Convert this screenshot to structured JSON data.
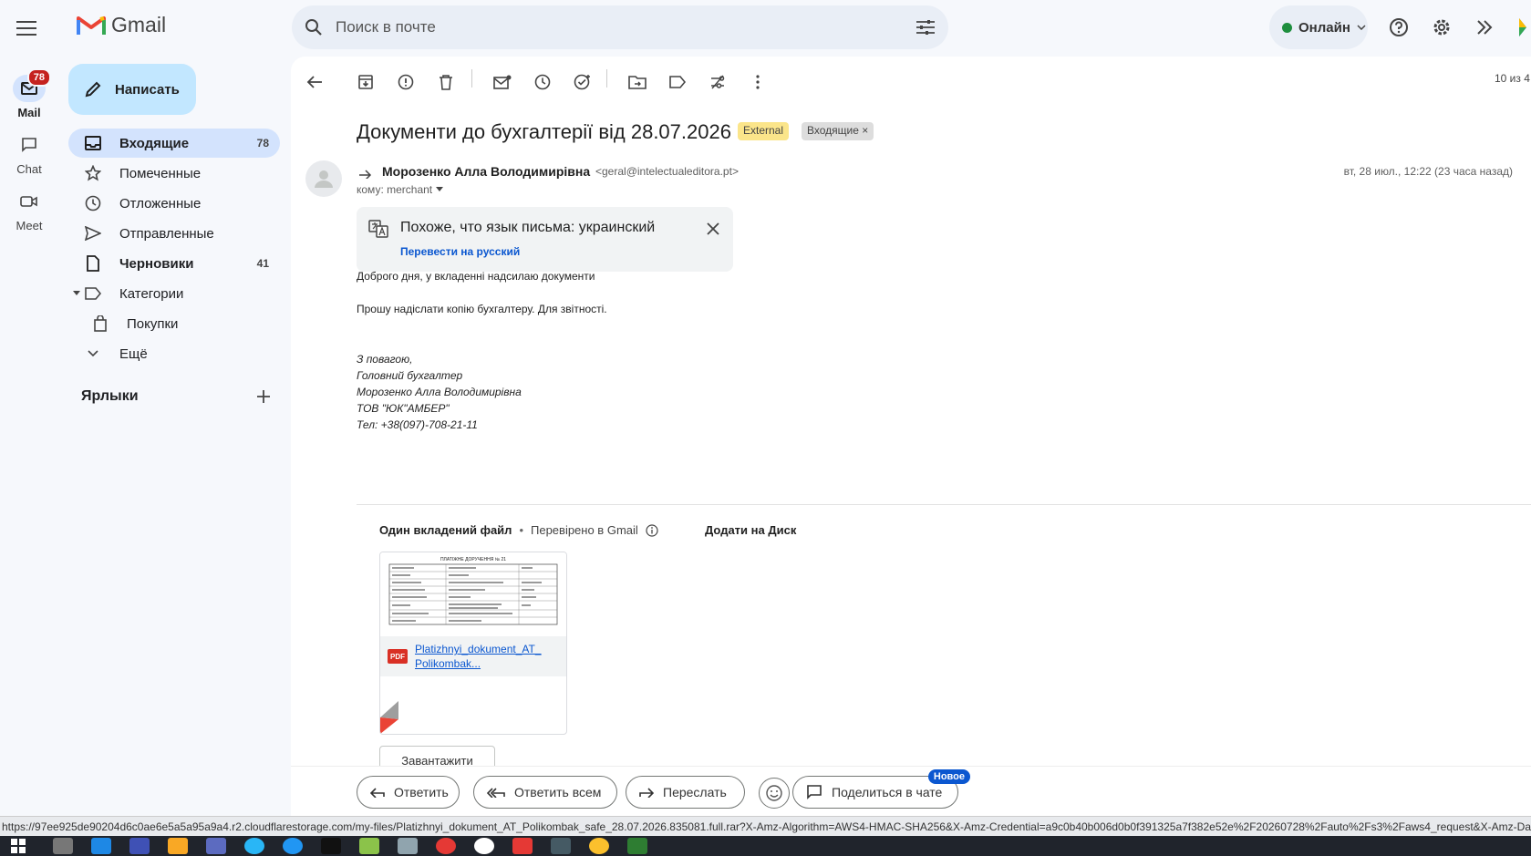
{
  "app": {
    "name": "Gmail"
  },
  "rail": {
    "items": [
      {
        "label": "Mail",
        "badge": "78"
      },
      {
        "label": "Chat"
      },
      {
        "label": "Meet"
      }
    ]
  },
  "search": {
    "placeholder": "Поиск в почте"
  },
  "status": {
    "label": "Онлайн",
    "color": "#1e8e3e"
  },
  "compose": {
    "label": "Написать"
  },
  "nav": {
    "items": [
      {
        "label": "Входящие",
        "count": "78"
      },
      {
        "label": "Помеченные"
      },
      {
        "label": "Отложенные"
      },
      {
        "label": "Отправленные"
      },
      {
        "label": "Черновики",
        "count": "41"
      },
      {
        "label": "Категории"
      },
      {
        "label": "Покупки"
      },
      {
        "label": "Ещё"
      }
    ]
  },
  "labels": {
    "title": "Ярлыки"
  },
  "pager": {
    "text": "10 из 4"
  },
  "email": {
    "subject": "Документи до бухгалтерії від 28.07.2026",
    "tags": [
      "External",
      "Входящие ×"
    ],
    "sender_name": "Морозенко Алла Володимирівна",
    "sender_email": "<geral@intelectualeditora.pt>",
    "to": "кому: merchant",
    "date": "вт, 28 июл., 12:22 (23 часа назад)",
    "translate": {
      "text": "Похоже, что язык письма: украинский",
      "link": "Перевести на русский"
    },
    "body": [
      "Доброго дня, у вкладенні надсилаю документи",
      "Прошу надіслати копію бухгалтеру. Для звітності."
    ],
    "signature": [
      "З повагою,",
      "Головний бухгалтер",
      "Морозенко Алла Володимирівна",
      "ТОВ \"ЮК\"АМБЕР\"",
      "Тел: +38(097)-708-21-11"
    ]
  },
  "attachments": {
    "title": "Один вкладений файл",
    "verified": "Перевірено в Gmail",
    "drive": "Додати на Диск",
    "file_name_1": "Platizhnyi_dokument_AT_",
    "file_name_2": "Polikombak...",
    "file_type": "PDF",
    "download": "Завантажити",
    "thumb_title": "ПЛАТІЖНЕ ДОРУЧЕННЯ № 21"
  },
  "actions": {
    "reply": "Ответить",
    "reply_all": "Ответить всем",
    "forward": "Переслать",
    "share": "Поделиться в чате",
    "new_badge": "Новое"
  },
  "status_url": "https://97ee925de90204d6c0ae6e5a5a95a9a4.r2.cloudflarestorage.com/my-files/Platizhnyi_dokument_AT_Polikombak_safe_28.07.2026.835081.full.rar?X-Amz-Algorithm=AWS4-HMAC-SHA256&X-Amz-Credential=a9c0b40b006d0b0f391325a7f382e52e%2F20260728%2Fauto%2Fs3%2Faws4_request&X-Amz-Date=20260"
}
